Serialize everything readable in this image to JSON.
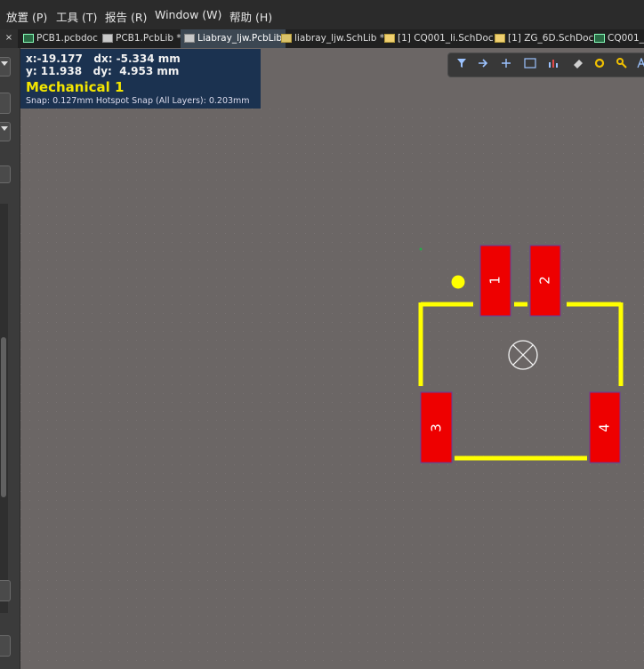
{
  "menu": [
    {
      "label": "放置 (P)"
    },
    {
      "label": "工具 (T)"
    },
    {
      "label": "报告 (R)"
    },
    {
      "label": "Window (W)"
    },
    {
      "label": "帮助 (H)"
    }
  ],
  "tabs": [
    {
      "label": "PCB1.pcbdoc",
      "icon": "pcb-doc-icon",
      "active": false
    },
    {
      "label": "PCB1.PcbLib *",
      "icon": "pcb-lib-icon",
      "active": false
    },
    {
      "label": "Liabray_ljw.PcbLib",
      "icon": "pcb-lib-icon",
      "active": true
    },
    {
      "label": "liabray_ljw.SchLib *",
      "icon": "sch-lib-icon",
      "active": false
    },
    {
      "label": "[1] CQ001_li.SchDoc",
      "icon": "folder-icon",
      "active": false
    },
    {
      "label": "[1] ZG_6D.SchDoc",
      "icon": "folder-icon",
      "active": false
    },
    {
      "label": "CQ001_",
      "icon": "pcb-doc-icon",
      "active": false
    }
  ],
  "tab_close": "×",
  "info": {
    "line1": "x:-19.177   dx: -5.334 mm",
    "line2": "y: 11.938   dy:  4.953 mm",
    "layer": "Mechanical 1",
    "snap": "Snap: 0.127mm Hotspot Snap (All Layers): 0.203mm"
  },
  "toolbar_icons": [
    "filter-icon",
    "route-icon",
    "plus-icon",
    "select-rect-icon",
    "chart-icon",
    "eraser-icon",
    "via-icon",
    "pin-icon",
    "text-icon"
  ],
  "pads": [
    {
      "label": "1"
    },
    {
      "label": "2"
    },
    {
      "label": "3"
    },
    {
      "label": "4"
    }
  ],
  "colors": {
    "canvas": "#6b6665",
    "pad": "#ee0000",
    "silkscreen": "#ffff00",
    "info_layer": "#f3e600"
  }
}
